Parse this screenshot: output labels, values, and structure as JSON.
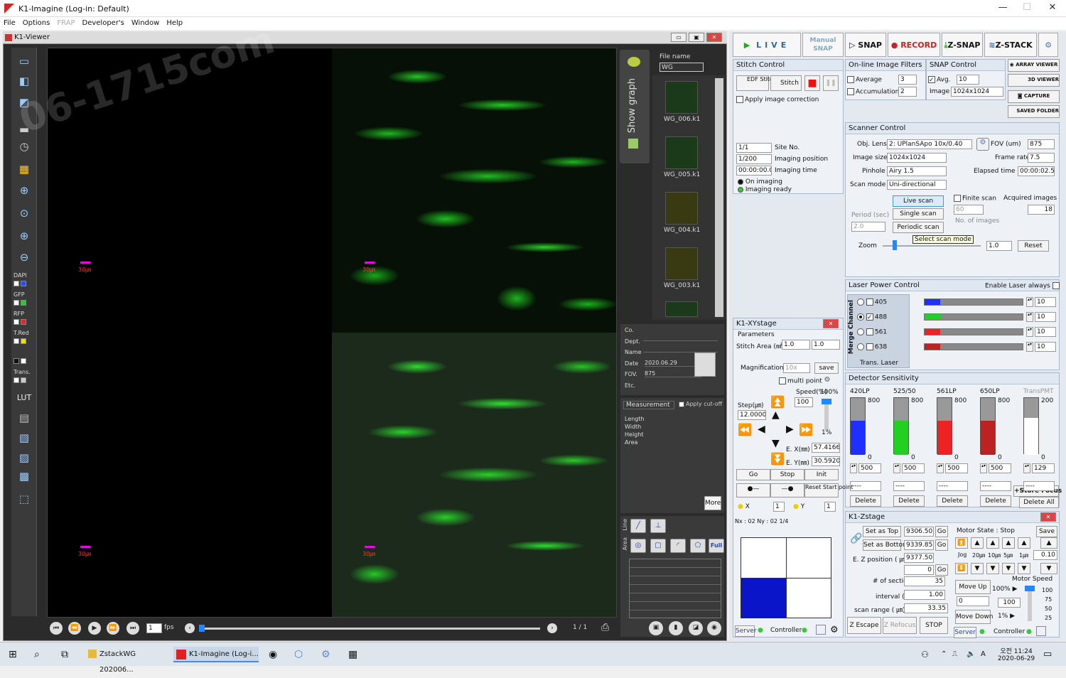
{
  "window": {
    "title": "K1-Imagine   (Log-in: Default)"
  },
  "menu": [
    "File",
    "Options",
    "FRAP",
    "Developer's",
    "Window",
    "Help"
  ],
  "viewer": {
    "title": "K1-Viewer",
    "scale_label": "30㎛"
  },
  "channels": [
    {
      "name": "DAPI",
      "color": "#1f4fff"
    },
    {
      "name": "GFP",
      "color": "#21d021"
    },
    {
      "name": "RFP",
      "color": "#e22"
    },
    {
      "name": "T.Red",
      "color": "#f0e000"
    },
    {
      "name": "Trans.",
      "color": "#fff"
    }
  ],
  "playback": {
    "fps_value": "1",
    "fps_label": "fps",
    "frame": "1 / 1"
  },
  "showgraph": {
    "label": "Show graph"
  },
  "thumbs": {
    "file_name_label": "File name",
    "file_name_value": "WG",
    "items": [
      "WG_006.k1",
      "WG_005.k1",
      "WG_004.k1",
      "WG_003.k1"
    ]
  },
  "info": {
    "co": "Co.",
    "dept": "Dept.",
    "name": "Name",
    "date": "Date",
    "date_value": "2020.06.29",
    "fov": "FOV.",
    "fov_value": "875",
    "etc": "Etc."
  },
  "measure": {
    "tab": "Measurement",
    "cutoff": "Apply cut-off",
    "length": "Length",
    "width": "Width",
    "height": "Height",
    "area": "Area",
    "more": "More",
    "full": "Full",
    "line": "Line",
    "area_tab": "Area"
  },
  "top": {
    "live": "LIVE",
    "manual": "Manual SNAP",
    "snap": "SNAP",
    "record": "RECORD",
    "zsnap": "Z-SNAP",
    "zstack": "Z-STACK"
  },
  "stitch": {
    "title": "Stitch Control",
    "edf": "EDF Stitch",
    "stitch": "Stitch",
    "apply": "Apply image correction",
    "site": "1/1",
    "site_l": "Site No.",
    "pos": "1/200",
    "pos_l": "Imaging position",
    "time": "00:00:00.0",
    "time_l": "Imaging time",
    "on": "On imaging",
    "ready": "Imaging ready"
  },
  "filters": {
    "title": "On-line Image Filters",
    "average": "Average",
    "avg_v": "3",
    "accum": "Accumulation",
    "acc_v": "2"
  },
  "snapctl": {
    "title": "SNAP Control",
    "avg": "Avg.",
    "avg_v": "10",
    "image": "Image",
    "image_v": "1024x1024"
  },
  "side": [
    "ARRAY VIEWER",
    "3D VIEWER",
    "CAPTURE",
    "SAVED FOLDER"
  ],
  "scanner": {
    "title": "Scanner Control",
    "lens_l": "Obj. Lens",
    "lens": "2: UPlanSApo 10x/0.40",
    "fov_l": "FOV (um)",
    "fov": "875",
    "size_l": "Image size",
    "size": "1024x1024",
    "fr_l": "Frame rate",
    "fr": "7.5",
    "pin_l": "Pinhole",
    "pin": "Airy 1.5",
    "el_l": "Elapsed time",
    "el": "00:00:02.5",
    "mode_l": "Scan mode",
    "mode": "Uni-directional",
    "live": "Live scan",
    "single": "Single scan",
    "periodic": "Periodic scan",
    "finite": "Finite scan",
    "acq_l": "Acquired images",
    "acq": "18",
    "period_l": "Period (sec)",
    "period": "2.0",
    "nimg": "60",
    "nimg_l": "No. of images",
    "tip": "Select scan mode",
    "zoom_l": "Zoom",
    "zoom": "1.0",
    "reset": "Reset"
  },
  "laser": {
    "title": "Laser Power Control",
    "enable": "Enable Laser always",
    "merge": "Merge Channel",
    "trans": "Trans. Laser",
    "lines": [
      {
        "nm": "405",
        "v": "10",
        "c": "#1f2fff",
        "frac": 0.1
      },
      {
        "nm": "488",
        "v": "10",
        "c": "#21d021",
        "frac": 0.1
      },
      {
        "nm": "561",
        "v": "10",
        "c": "#e22",
        "frac": 0.1
      },
      {
        "nm": "638",
        "v": "10",
        "c": "#b22",
        "frac": 0.1
      }
    ]
  },
  "detector": {
    "title": "Detector Sensitivity",
    "ch": [
      {
        "n": "420LP",
        "top": "800",
        "low": "0",
        "b": "500",
        "c": "#1f2fff",
        "frac": 0.6
      },
      {
        "n": "525/50",
        "top": "800",
        "low": "0",
        "b": "500",
        "c": "#21d021",
        "frac": 0.6
      },
      {
        "n": "561LP",
        "top": "800",
        "low": "0",
        "b": "500",
        "c": "#e22",
        "frac": 0.6
      },
      {
        "n": "650LP",
        "top": "800",
        "low": "0",
        "b": "500",
        "c": "#b22",
        "frac": 0.6
      },
      {
        "n": "TransPMT",
        "top": "200",
        "low": "0",
        "b": "129",
        "c": "#fff",
        "frac": 0.65
      }
    ],
    "dash": "----",
    "store": "Store Focus",
    "del": "Delete",
    "delall": "Delete All"
  },
  "xy": {
    "title": "K1-XYstage",
    "params": "Parameters",
    "area_l": "Stitch Area (㎟)",
    "a1": "1.0",
    "a2": "1.0",
    "mag_l": "Magnification",
    "mag": "10x",
    "save": "save",
    "multi": "multi point",
    "speed_l": "Speed(%)",
    "speed": "100%",
    "speed_v": "100",
    "step_l": "Step(㎛)",
    "step": "12.0000",
    "pct": "1%",
    "ex_l": "E. X(㎜)",
    "ex": "57.41660",
    "ey_l": "E. Y(㎜)",
    "ey": "30.59205",
    "go": "Go",
    "stop": "Stop",
    "init": "Init",
    "reset": "Reset Start point",
    "x_l": "X",
    "xv": "1",
    "y_l": "Y",
    "yv": "1",
    "nx": "Nx : 02  Ny : 02   1/4",
    "server": "Server",
    "ctrl": "Controller"
  },
  "z": {
    "title": "K1-Zstage",
    "settop": "Set as Top",
    "top": "9306.50",
    "go": "Go",
    "setbot": "Set as Bottom",
    "bot": "9339.85",
    "ez_l": "E. Z position  ( ㎛)",
    "ez": "9377.50",
    "zero": "0",
    "sec_l": "# of section",
    "sec": "35",
    "int_l": "interval  ( ㎛)",
    "int": "1.00",
    "range_l": "scan range  ( ㎛)",
    "range": "33.35",
    "motor": "Motor State :  Stop",
    "save": "Save",
    "jog": "Jog",
    "j1": "20㎛",
    "j2": "10㎛",
    "j3": "5㎛",
    "j4": "1㎛",
    "jv": "0.10",
    "mup": "Move Up",
    "mv": "0",
    "mdown": "Move Down",
    "ms": "Motor Speed",
    "ms100": "100%",
    "ms1": "1%",
    "msv": "100",
    "m_scale": [
      "100",
      "75",
      "50",
      "25"
    ],
    "esc": "Z Escape",
    "ref": "Z Refocus",
    "stop": "STOP",
    "server": "Server",
    "ctrl": "Controller"
  },
  "taskbar": {
    "t1": "ZstackWG 202006...",
    "t2": "K1-Imagine  (Log-i...",
    "time": "오전 11:24",
    "date": "2020-06-29"
  },
  "watermark": "06-1715com"
}
